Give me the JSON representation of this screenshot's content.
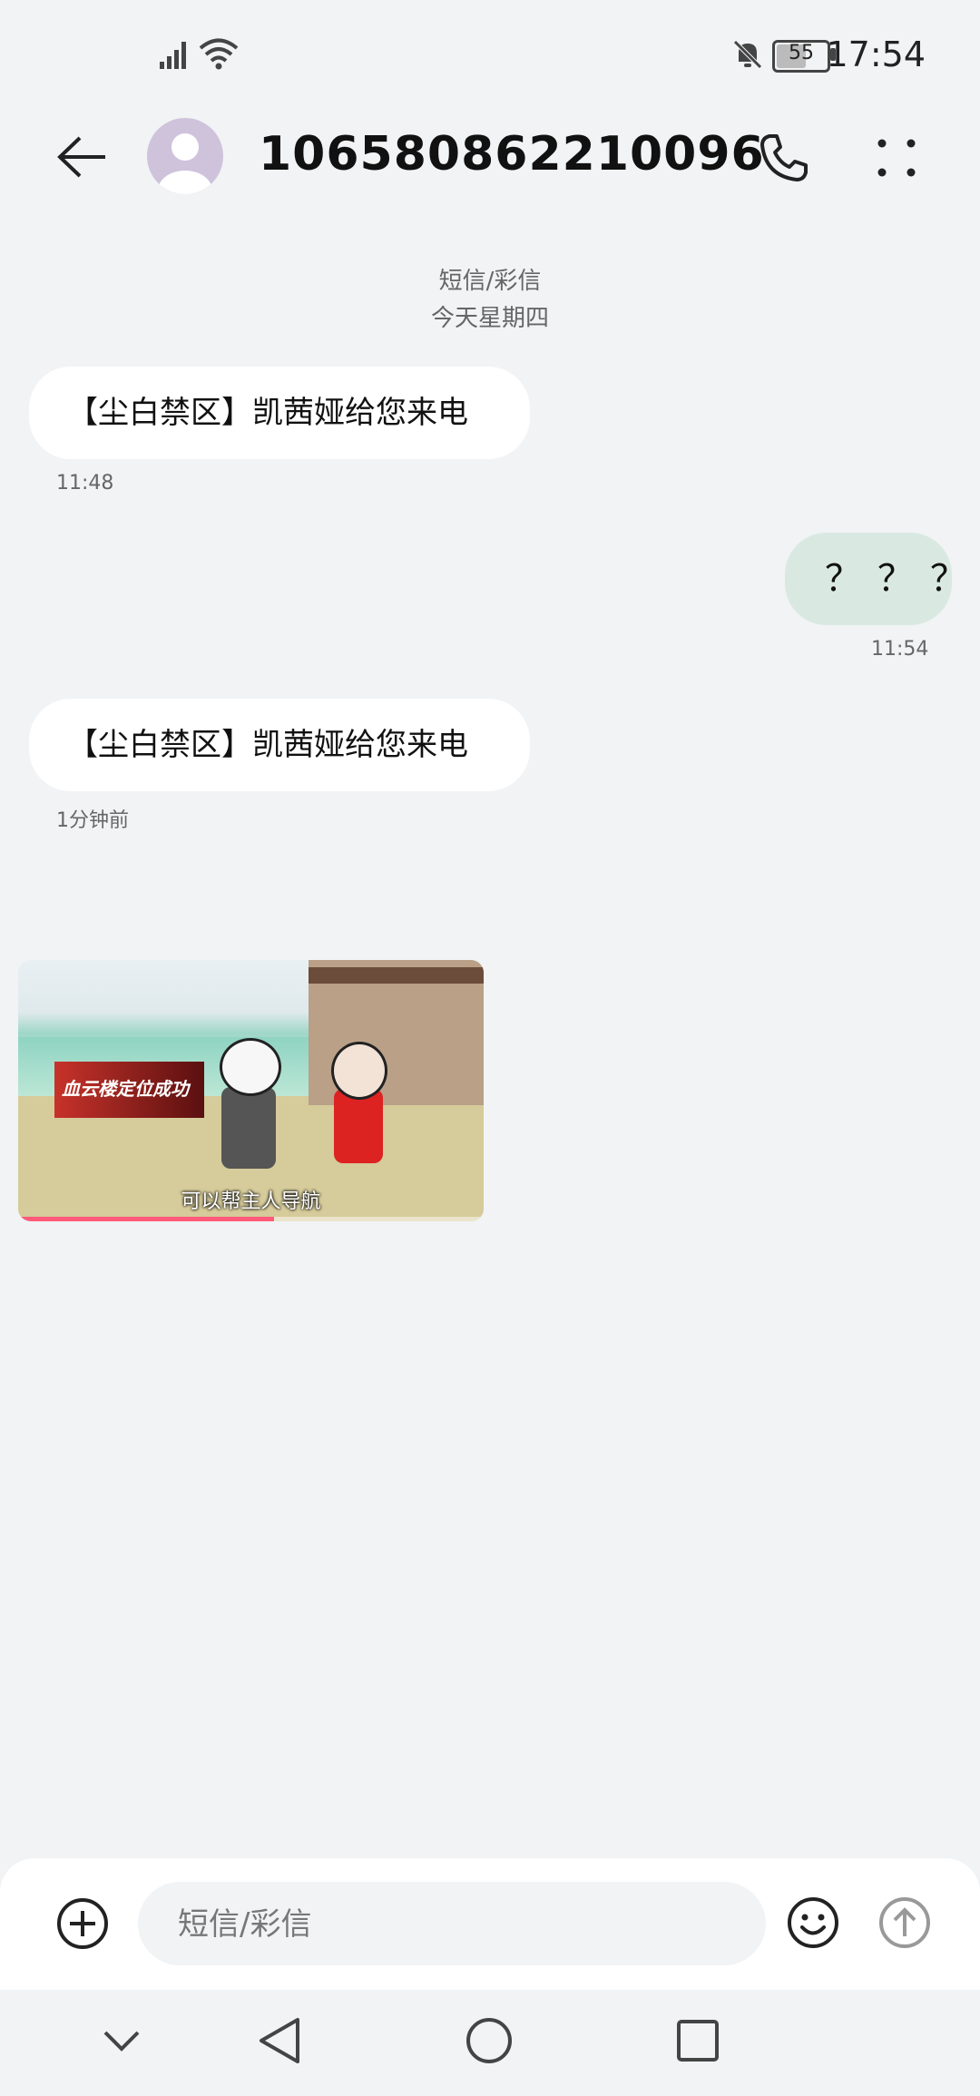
{
  "status_bar": {
    "time": "17:54",
    "battery": "55",
    "icons": [
      "signal-icon",
      "wifi-icon",
      "mute-icon",
      "battery-icon"
    ]
  },
  "header": {
    "title": "106580862210096",
    "icons": [
      "back-arrow-icon",
      "avatar-icon",
      "phone-icon",
      "more-icon"
    ]
  },
  "conversation": {
    "type_label": "短信/彩信",
    "date_label": "今天星期四",
    "messages": [
      {
        "direction": "in",
        "text": "【尘白禁区】凯茜娅给您来电",
        "time": "11:48"
      },
      {
        "direction": "out",
        "text": "？？？",
        "time": "11:54"
      },
      {
        "direction": "in",
        "text": "【尘白禁区】凯茜娅给您来电",
        "time": "1分钟前"
      }
    ],
    "video": {
      "caption": "可以帮主人导航",
      "sign_text": "血云楼定位成功",
      "progress": 0.55
    }
  },
  "composer": {
    "placeholder": "短信/彩信",
    "icons": [
      "add-icon",
      "emoji-icon",
      "send-icon"
    ]
  },
  "navbar": {
    "icons": [
      "nav-down-icon",
      "nav-back-icon",
      "nav-home-icon",
      "nav-recents-icon"
    ]
  }
}
